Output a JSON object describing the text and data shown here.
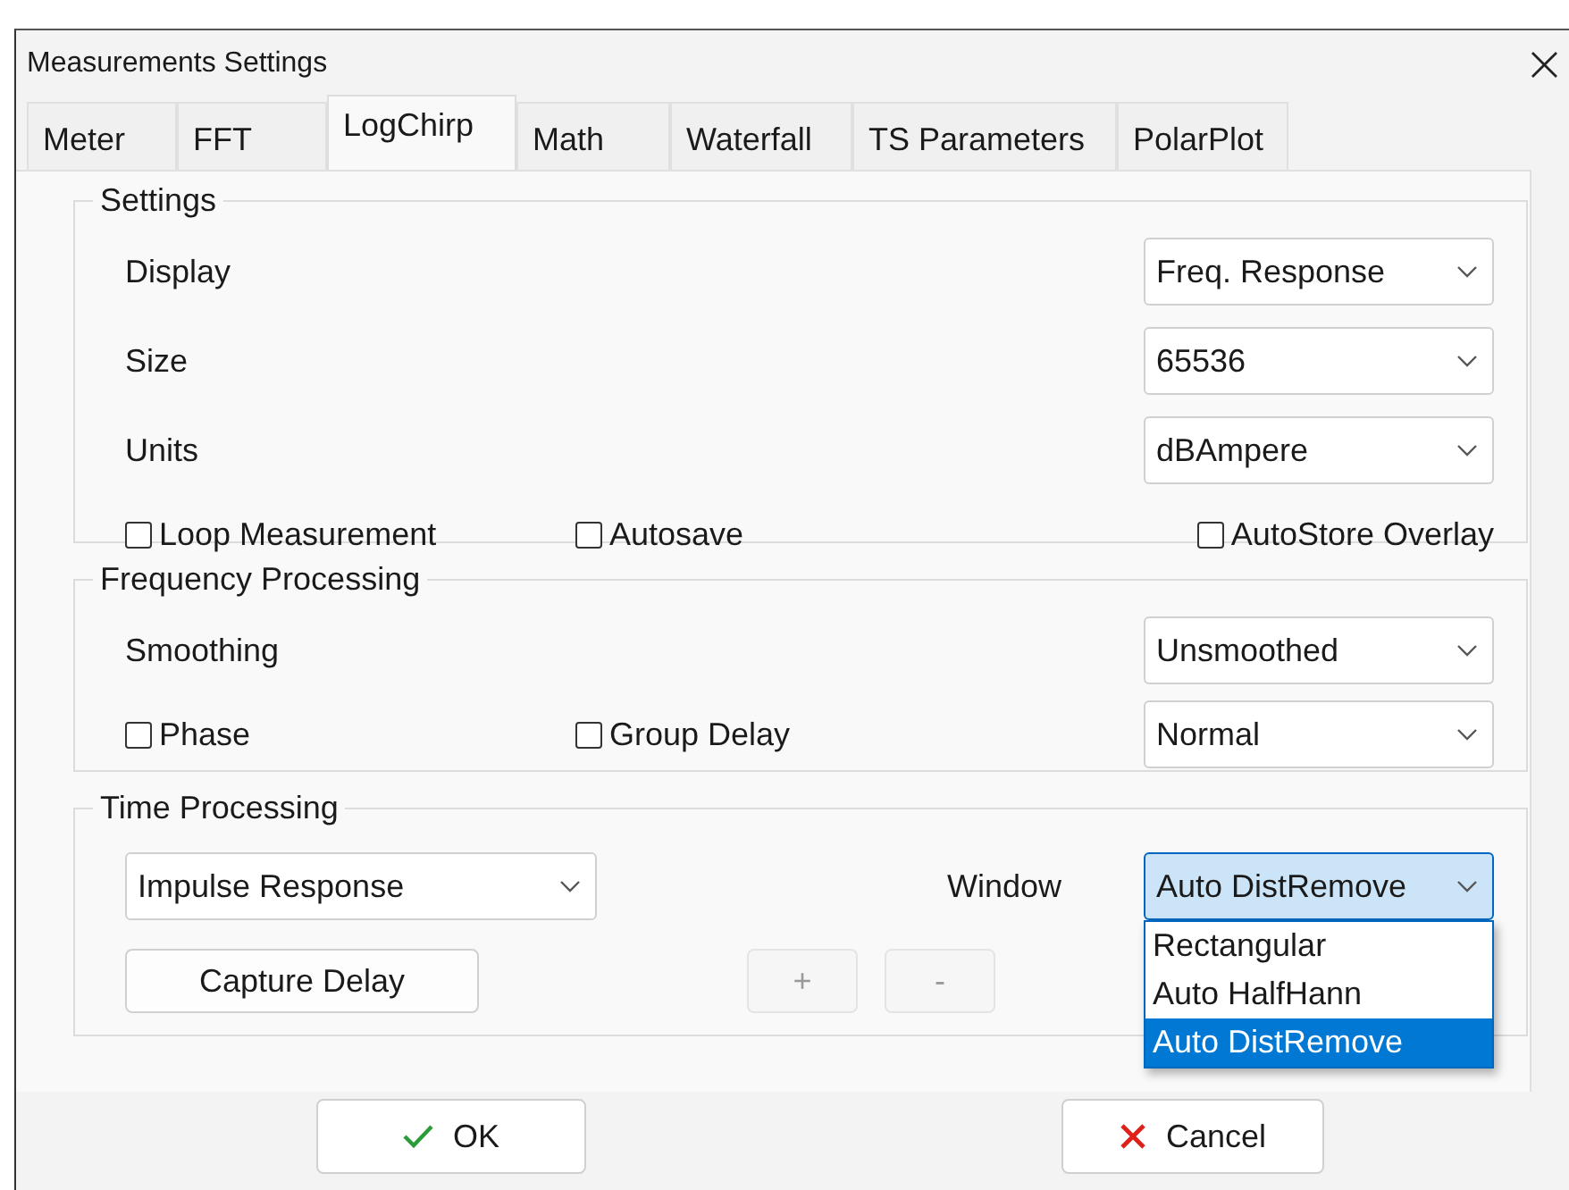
{
  "window": {
    "title": "Measurements Settings",
    "close": "×"
  },
  "tabs": [
    {
      "label": "Meter",
      "selected": false
    },
    {
      "label": "FFT",
      "selected": false
    },
    {
      "label": "LogChirp",
      "selected": true
    },
    {
      "label": "Math",
      "selected": false
    },
    {
      "label": "Waterfall",
      "selected": false
    },
    {
      "label": "TS Parameters",
      "selected": false
    },
    {
      "label": "PolarPlot",
      "selected": false
    }
  ],
  "settings": {
    "title": "Settings",
    "fields": [
      {
        "label": "Display",
        "value": "Freq. Response"
      },
      {
        "label": "Size",
        "value": "65536"
      },
      {
        "label": "Units",
        "value": "dBAmpere"
      }
    ],
    "checkboxes": [
      {
        "label": "Loop Measurement",
        "checked": false
      },
      {
        "label": "Autosave",
        "checked": false
      },
      {
        "label": "AutoStore Overlay",
        "checked": false
      }
    ]
  },
  "frequency_processing": {
    "title": "Frequency Processing",
    "smoothing": {
      "label": "Smoothing",
      "value": "Unsmoothed"
    },
    "checkboxes": [
      {
        "label": "Phase",
        "checked": false
      },
      {
        "label": "Group Delay",
        "checked": false
      }
    ],
    "mode": {
      "value": "Normal"
    }
  },
  "time_processing": {
    "title": "Time Processing",
    "type": {
      "value": "Impulse Response"
    },
    "window": {
      "label": "Window",
      "value": "Auto DistRemove",
      "expanded": true,
      "options": [
        {
          "label": "Rectangular",
          "selected": false
        },
        {
          "label": "Auto HalfHann",
          "selected": false
        },
        {
          "label": "Auto DistRemove",
          "selected": true
        }
      ]
    },
    "buttons": [
      {
        "label": "Capture Delay",
        "disabled": false,
        "kind": "capture"
      },
      {
        "label": "+",
        "disabled": true,
        "kind": "step"
      },
      {
        "label": "-",
        "disabled": true,
        "kind": "step"
      }
    ]
  },
  "buttons": [
    {
      "label": "OK",
      "kind": "ok"
    },
    {
      "label": "Cancel",
      "kind": "cancel"
    }
  ]
}
